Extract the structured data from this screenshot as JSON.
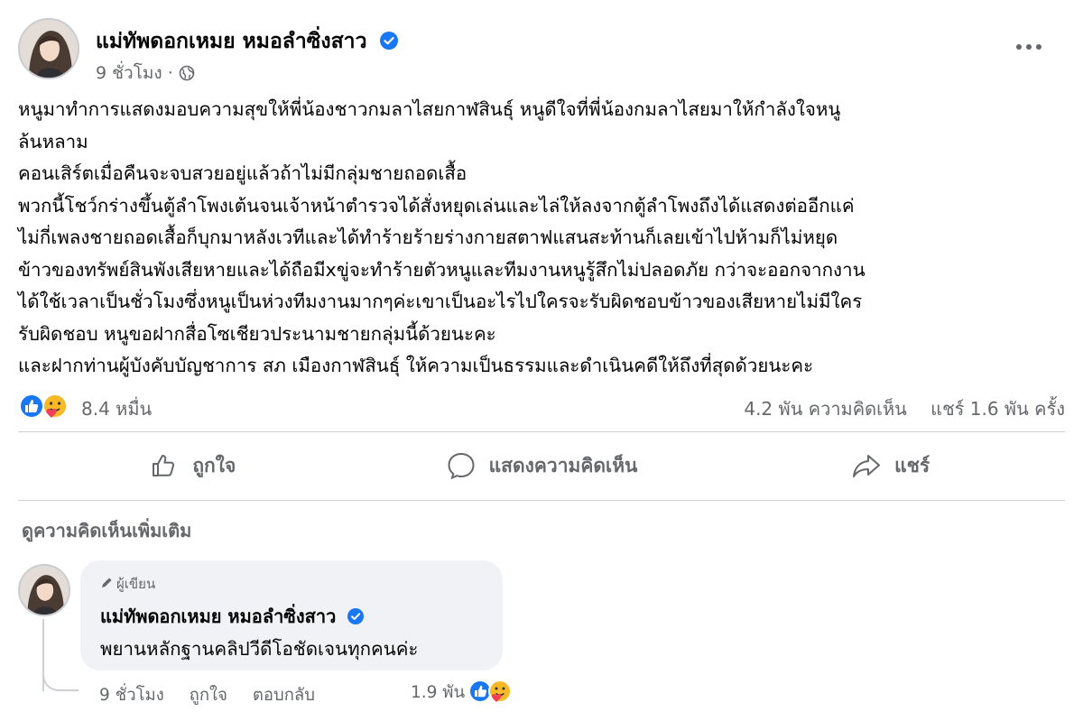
{
  "post": {
    "author": "แม่ทัพดอกเหมย หมอลำซิ่งสาว",
    "time": "9 ชั่วโมง",
    "separator": "·",
    "lines": [
      "หนูมาทำการแสดงมอบความสุขให้พี่น้องชาวกมลาไสยกาฬสินธุ์  หนูดีใจที่พี่น้องกมลาไสยมาให้กำลังใจหนู",
      "ล้นหลาม",
      "คอนเสิร์ตเมื่อคืนจะจบสวยอยู่แล้วถ้าไม่มีกลุ่มชายถอดเสื้อ",
      "พวกนี้โชว์กร่างขึ้นตู้ลำโพงเต้นจนเจ้าหน้าตำรวจได้สั่งหยุดเล่นและไล่ให้ลงจากตู้ลำโพงถึงได้แสดงต่ออีกแค่",
      "ไม่กี่เพลงชายถอดเสื้อก็บุกมาหลังเวทีและได้ทำร้ายร้ายร่างกายสตาฟแสนสะท้านก็เลยเข้าไปห้ามก็ไม่หยุด",
      "ข้าวของทรัพย์สินพังเสียหายและได้ถือมีxขู่จะทำร้ายตัวหนูและทีมงานหนูรู้สึกไม่ปลอดภัย กว่าจะออกจากงาน",
      "ได้ใช้เวลาเป็นชั่วโมงซึ่งหนูเป็นห่วงทีมงานมากๆค่ะเขาเป็นอะไรไปใครจะรับผิดชอบข้าวของเสียหายไม่มีใคร",
      "รับผิดชอบ หนูขอฝากสื่อโซเชียวประนามชายกลุ่มนี้ด้วยนะคะ",
      "และฝากท่านผู้บังคับบัญชาการ สภ เมืองกาฬสินธุ์ ให้ความเป็นธรรมและดำเนินคดีให้ถึงที่สุดด้วยนะคะ"
    ]
  },
  "stats": {
    "reactions": "8.4 หมื่น",
    "comments": "4.2 พัน ความคิดเห็น",
    "shares": "แชร์ 1.6 พัน ครั้ง"
  },
  "actions": {
    "like": "ถูกใจ",
    "comment": "แสดงความคิดเห็น",
    "share": "แชร์"
  },
  "more_comments": "ดูความคิดเห็นเพิ่มเติม",
  "comment": {
    "badge": "ผู้เขียน",
    "author": "แม่ทัพดอกเหมย หมอลำซิ่งสาว",
    "text": "พยานหลักฐานคลิปวีดีโอชัดเจนทุกคนค่ะ",
    "time": "9 ชั่วโมง",
    "like": "ถูกใจ",
    "reply": "ตอบกลับ",
    "reactions": "1.9 พัน"
  },
  "colors": {
    "verified": "#1877f2",
    "like_blue": "#1877f2",
    "care_yellow": "#f7b928",
    "muted": "#65676b"
  }
}
